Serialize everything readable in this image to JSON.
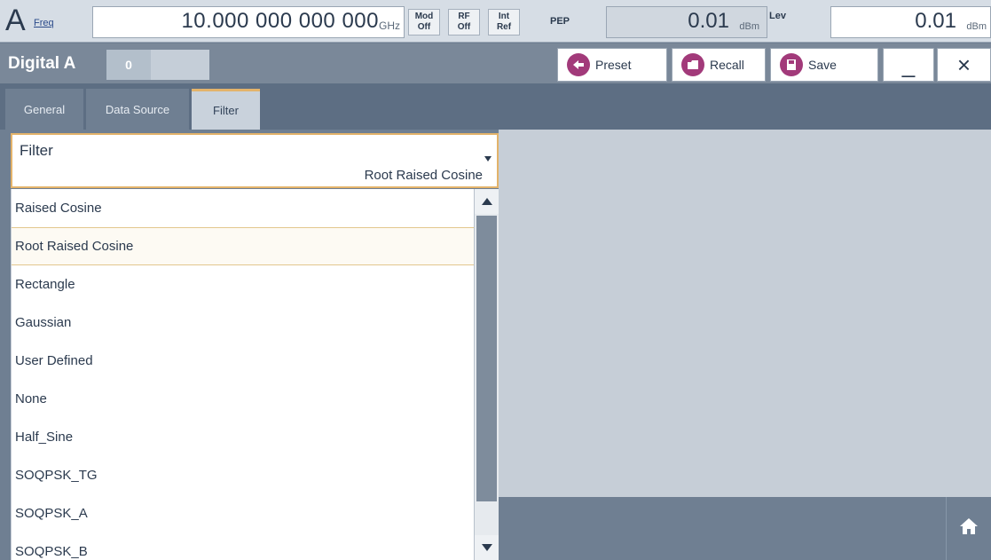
{
  "topbar": {
    "channel_letter": "A",
    "freq_label": "Freq",
    "freq_value": "10.000 000 000 000",
    "freq_unit": "GHz",
    "badges": [
      {
        "line1": "Mod",
        "line2": "Off"
      },
      {
        "line1": "RF",
        "line2": "Off"
      },
      {
        "line1": "Int",
        "line2": "Ref"
      }
    ],
    "pep_label": "PEP",
    "pep_value": "0.01",
    "pep_unit": "dBm",
    "lev_label": "Lev",
    "lev_value": "0.01",
    "lev_unit": "dBm"
  },
  "titlebar": {
    "title": "Digital A",
    "field_value": "0",
    "preset_label": "Preset",
    "recall_label": "Recall",
    "save_label": "Save",
    "minimize_label": "_",
    "close_label": "×"
  },
  "tabs": [
    {
      "label": "General"
    },
    {
      "label": "Data Source"
    },
    {
      "label": "Filter"
    }
  ],
  "filter": {
    "label": "Filter",
    "value": "Root Raised Cosine",
    "options": [
      "Raised Cosine",
      "Root Raised Cosine",
      "Rectangle",
      "Gaussian",
      "User Defined",
      "None",
      "Half_Sine",
      "SOQPSK_TG",
      "SOQPSK_A",
      "SOQPSK_B"
    ]
  },
  "colors": {
    "accent": "#e3b36a",
    "button_icon": "#a23a7a",
    "panel": "#6f7f92"
  }
}
